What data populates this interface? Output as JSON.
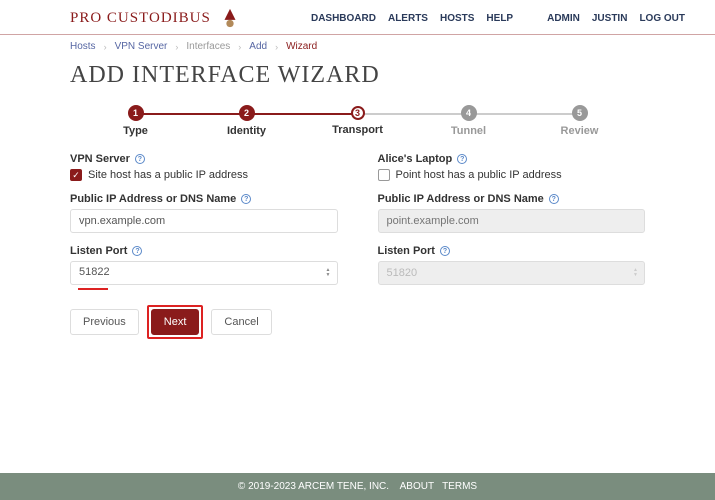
{
  "brand": "PRO CUSTODIBUS",
  "nav": {
    "dashboard": "DASHBOARD",
    "alerts": "ALERTS",
    "hosts": "HOSTS",
    "help": "HELP",
    "admin": "ADMIN",
    "user": "JUSTIN",
    "logout": "LOG OUT"
  },
  "breadcrumb": {
    "hosts": "Hosts",
    "vpn": "VPN Server",
    "interfaces": "Interfaces",
    "add": "Add",
    "wizard": "Wizard"
  },
  "title": "ADD INTERFACE WIZARD",
  "steps": {
    "s1": "Type",
    "s2": "Identity",
    "s3": "Transport",
    "s4": "Tunnel",
    "s5": "Review",
    "n1": "1",
    "n2": "2",
    "n3": "3",
    "n4": "4",
    "n5": "5"
  },
  "left": {
    "host_label": "VPN Server",
    "pubip_check": "Site host has a public IP address",
    "ip_label": "Public IP Address or DNS Name",
    "ip_value": "vpn.example.com",
    "port_label": "Listen Port",
    "port_value": "51822"
  },
  "right": {
    "host_label": "Alice's Laptop",
    "pubip_check": "Point host has a public IP address",
    "ip_label": "Public IP Address or DNS Name",
    "ip_placeholder": "point.example.com",
    "port_label": "Listen Port",
    "port_value": "51820"
  },
  "buttons": {
    "prev": "Previous",
    "next": "Next",
    "cancel": "Cancel"
  },
  "footer": {
    "copyright": "© 2019-2023 ARCEM TENE, INC.",
    "about": "ABOUT",
    "terms": "TERMS"
  }
}
